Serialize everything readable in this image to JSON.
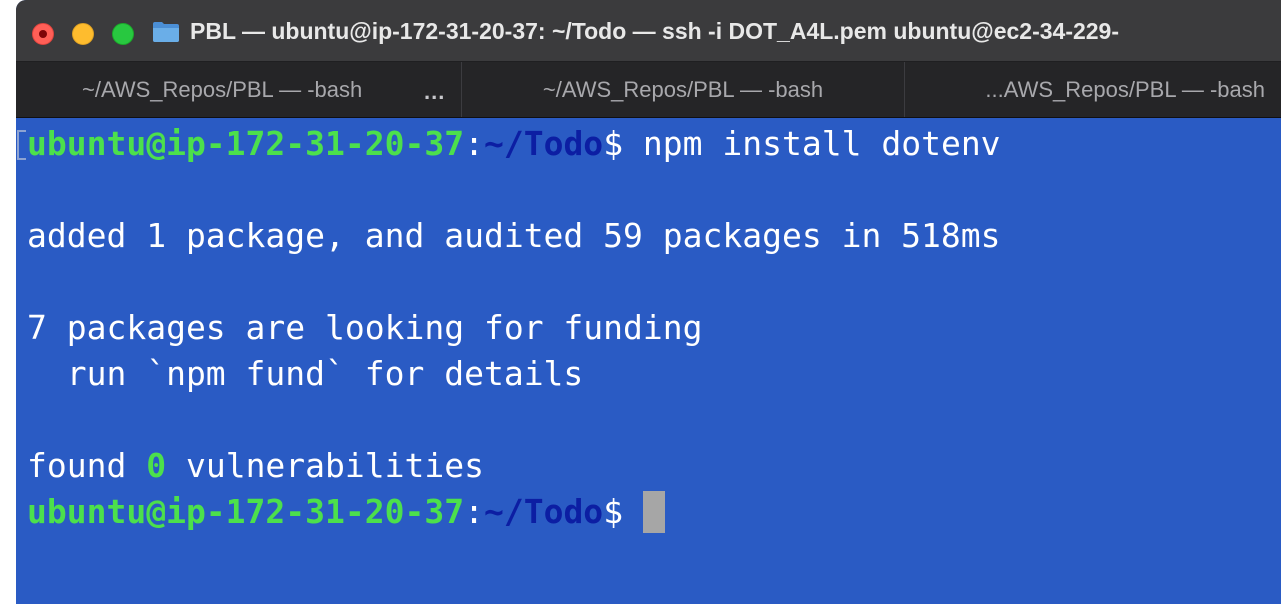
{
  "window": {
    "title": "PBL — ubuntu@ip-172-31-20-37: ~/Todo — ssh -i DOT_A4L.pem ubuntu@ec2-34-229-"
  },
  "tabs": [
    {
      "label": "~/AWS_Repos/PBL — -bash",
      "more": "..."
    },
    {
      "label": "~/AWS_Repos/PBL — -bash"
    },
    {
      "label": "...AWS_Repos/PBL — -bash"
    }
  ],
  "colors": {
    "terminal_bg": "#2a5bc4",
    "prompt_user": "#4ce04c",
    "prompt_path": "#0c1ea3"
  },
  "terminal": {
    "prompt": {
      "user_host": "ubuntu@ip-172-31-20-37",
      "colon": ":",
      "path": "~/Todo",
      "dollar": "$"
    },
    "command": " npm install dotenv",
    "output_added": "added 1 package, and audited 59 packages in 518ms",
    "output_funding": "7 packages are looking for funding",
    "output_fund_hint": "  run `npm fund` for details",
    "output_found_prefix": "found ",
    "output_found_count": "0",
    "output_found_suffix": " vulnerabilities"
  }
}
